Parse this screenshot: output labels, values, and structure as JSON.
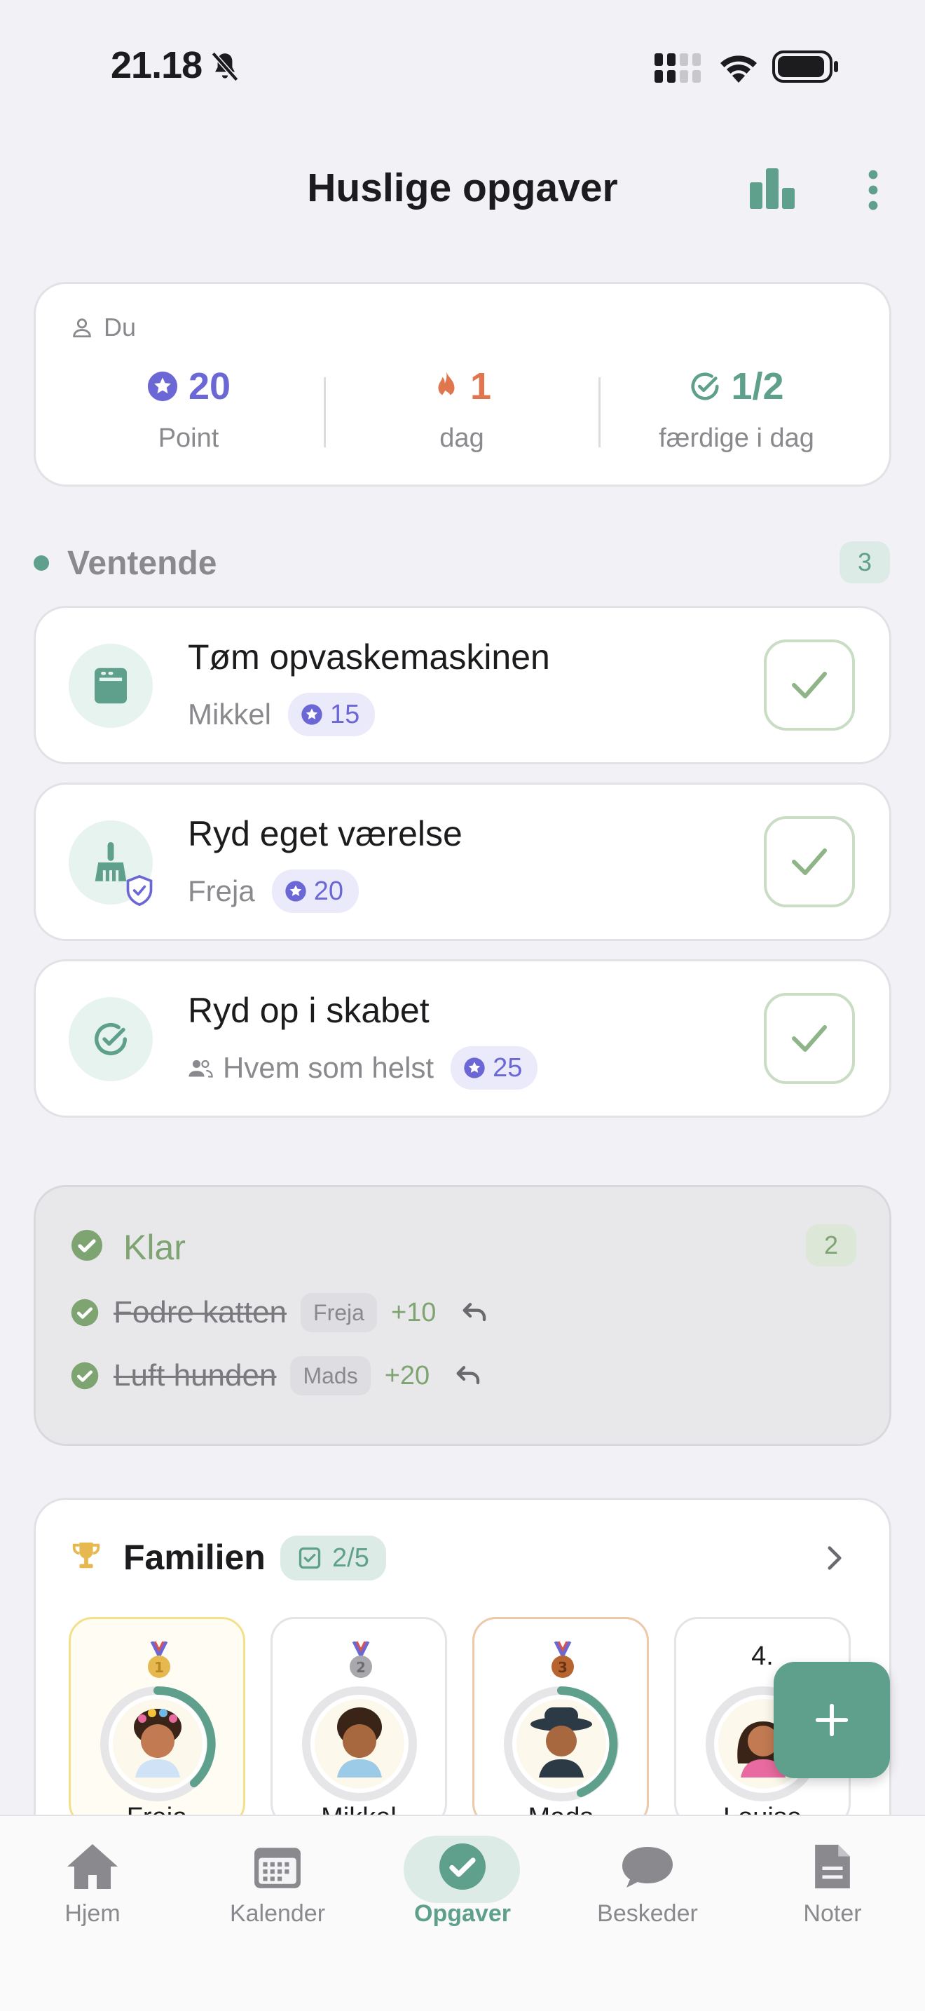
{
  "status_bar": {
    "time": "21.18"
  },
  "header": {
    "title": "Huslige opgaver"
  },
  "user_card": {
    "label": "Du",
    "points_value": "20",
    "points_label": "Point",
    "streak_value": "1",
    "streak_label": "dag",
    "done_value": "1/2",
    "done_label": "færdige i dag"
  },
  "pending": {
    "title": "Ventende",
    "count": "3",
    "tasks": [
      {
        "title": "Tøm opvaskemaskinen",
        "assignee": "Mikkel",
        "points": "15",
        "icon": "dishwasher-icon"
      },
      {
        "title": "Ryd eget værelse",
        "assignee": "Freja",
        "points": "20",
        "icon": "broom-icon"
      },
      {
        "title": "Ryd op i skabet",
        "assignee": "Hvem som helst",
        "points": "25",
        "icon": "check-circle-icon"
      }
    ]
  },
  "done": {
    "title": "Klar",
    "count": "2",
    "items": [
      {
        "name": "Fodre katten",
        "person": "Freja",
        "points": "+10"
      },
      {
        "name": "Luft hunden",
        "person": "Mads",
        "points": "+20"
      }
    ]
  },
  "family": {
    "title": "Familien",
    "progress": "2/5",
    "members": [
      {
        "name": "Freja",
        "rank": "1"
      },
      {
        "name": "Mikkel",
        "rank": "2"
      },
      {
        "name": "Mads",
        "rank": "3"
      },
      {
        "name": "Louise",
        "rank": "4."
      }
    ]
  },
  "tabs": [
    {
      "label": "Hjem",
      "icon": "home-icon"
    },
    {
      "label": "Kalender",
      "icon": "calendar-icon"
    },
    {
      "label": "Opgaver",
      "icon": "check-circle-icon"
    },
    {
      "label": "Beskeder",
      "icon": "chat-bubble-icon"
    },
    {
      "label": "Noter",
      "icon": "document-icon"
    }
  ],
  "colors": {
    "accent": "#5fa08c",
    "points": "#6b68d6",
    "streak": "#e0764e",
    "done_green": "#7ea472"
  }
}
